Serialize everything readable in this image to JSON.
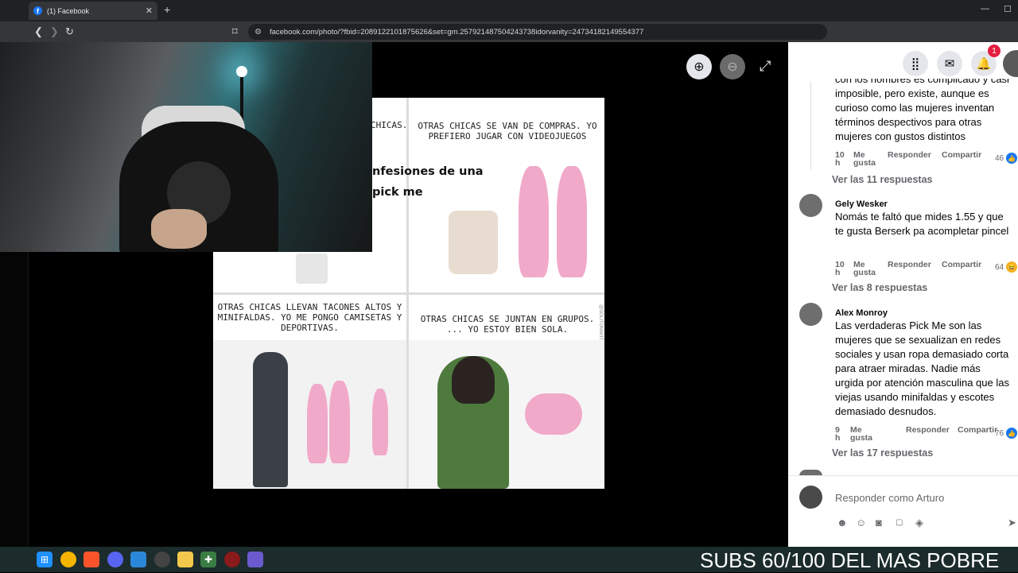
{
  "browser": {
    "tab_title": "(1) Facebook",
    "url": "facebook.com/photo/?fbid=2089122101875626&set=gm.257921487504243738idorvanity=24734182149554377"
  },
  "viewer": {
    "zoom_in_icon": "zoom-in-icon",
    "zoom_out_icon": "zoom-out-icon",
    "fullscreen_icon": "fullscreen-icon"
  },
  "meme": {
    "caption_top_left": "CHICAS.",
    "caption_top_right": "OTRAS CHICAS SE VAN DE COMPRAS. YO PREFIERO JUGAR CON VIDEOJUEGOS",
    "title": "nfesiones de una pick me",
    "caption_bottom_left": "OTRAS CHICAS LLEVAN TACONES ALTOS Y MINIFALDAS. YO ME PONGO CAMISETAS Y DEPORTIVAS.",
    "caption_bottom_right": "OTRAS CHICAS SE JUNTAN EN GRUPOS. ... YO ESTOY BIEN SOLA.",
    "watermark": "@SOLITOMAHT"
  },
  "topbar": {
    "notifications_count": "1"
  },
  "comments": [
    {
      "name": "",
      "text": "con los hombres es complicado y casi imposible, pero existe, aunque es curioso como las mujeres inventan términos despectivos para otras mujeres con gustos distintos",
      "time": "10 h",
      "like": "Me gusta",
      "reply": "Responder",
      "share": "Compartir",
      "reactions": "46",
      "replies": "Ver las 11 respuestas"
    },
    {
      "name": "Gely Wesker",
      "text": "Nomás te faltó que mides 1.55 y que te gusta Berserk pa acompletar pincel",
      "time": "10 h",
      "like": "Me gusta",
      "reply": "Responder",
      "share": "Compartir",
      "reactions": "64",
      "replies": "Ver las 8 respuestas"
    },
    {
      "name": "Alex Monroy",
      "text": "Las verdaderas Pick Me son las mujeres que se sexualizan en redes sociales y usan ropa demasiado corta para atraer miradas. Nadie más urgida por atención masculina que las viejas usando minifaldas y escotes demasiado desnudos.",
      "time": "9 h",
      "like": "Me gusta",
      "reply": "Responder",
      "share": "Compartir",
      "reactions": "76",
      "replies": "Ver las 17 respuestas"
    }
  ],
  "reply_box": {
    "placeholder": "Responder como Arturo"
  },
  "overlay": {
    "subs_text": "SUBS 60/100 DEL MAS POBRE"
  },
  "colors": {
    "facebook_blue": "#1877f2",
    "badge_red": "#e41e3f",
    "taskbar": "#1c2b2b"
  }
}
